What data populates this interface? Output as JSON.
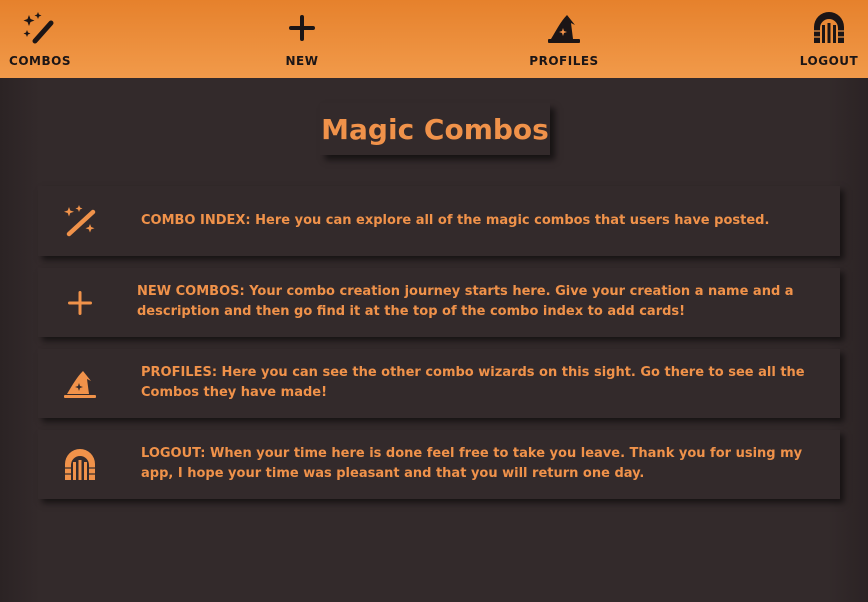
{
  "nav": {
    "items": [
      {
        "label": "COMBOS",
        "icon": "magic-wand-icon"
      },
      {
        "label": "NEW",
        "icon": "plus-icon"
      },
      {
        "label": "PROFILES",
        "icon": "wizard-hat-icon"
      },
      {
        "label": "LOGOUT",
        "icon": "dungeon-door-icon"
      }
    ]
  },
  "page": {
    "title": "Magic Combos"
  },
  "cards": [
    {
      "icon": "magic-wand-icon",
      "text": "COMBO INDEX: Here you can explore all of the magic combos that users have posted."
    },
    {
      "icon": "plus-icon",
      "text": "NEW COMBOS: Your combo creation journey starts here. Give your creation a name and a description and then go find it at the top of the combo index to add cards!"
    },
    {
      "icon": "wizard-hat-icon",
      "text": "PROFILES: Here you can see the other combo wizards on this sight. Go there to see all the Combos they have made!"
    },
    {
      "icon": "dungeon-door-icon",
      "text": "LOGOUT: When your time here is done feel free to take you leave. Thank you for using my app, I hope your time was pleasant and that you will return one day."
    }
  ],
  "colors": {
    "accent": "#f0924a",
    "header_top": "#e6812c",
    "background": "#332a2b",
    "icon_dark": "#1b1516"
  }
}
